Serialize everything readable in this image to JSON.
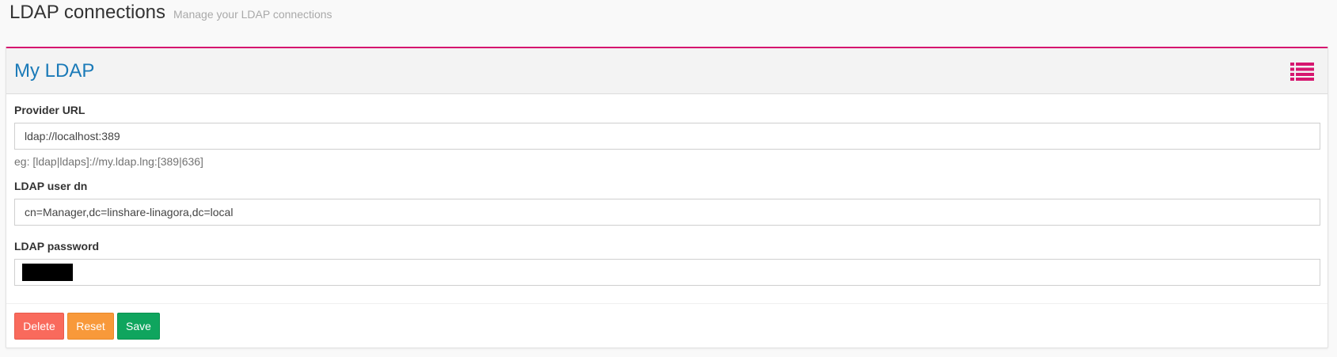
{
  "header": {
    "title": "LDAP connections",
    "subtitle": "Manage your LDAP connections"
  },
  "panel": {
    "title": "My LDAP",
    "menu_icon": "list-icon"
  },
  "form": {
    "provider_url": {
      "label": "Provider URL",
      "value": "ldap://localhost:389",
      "help": "eg: [ldap|ldaps]://my.ldap.lng:[389|636]"
    },
    "user_dn": {
      "label": "LDAP user dn",
      "value": "cn=Manager,dc=linshare-linagora,dc=local"
    },
    "password": {
      "label": "LDAP password",
      "masked": true
    }
  },
  "actions": {
    "delete_label": "Delete",
    "reset_label": "Reset",
    "save_label": "Save"
  },
  "colors": {
    "accent_border": "#d6166f",
    "title_blue": "#1a7ab8",
    "delete": "#f96a5c",
    "reset": "#f8993a",
    "save": "#0fa55e"
  }
}
